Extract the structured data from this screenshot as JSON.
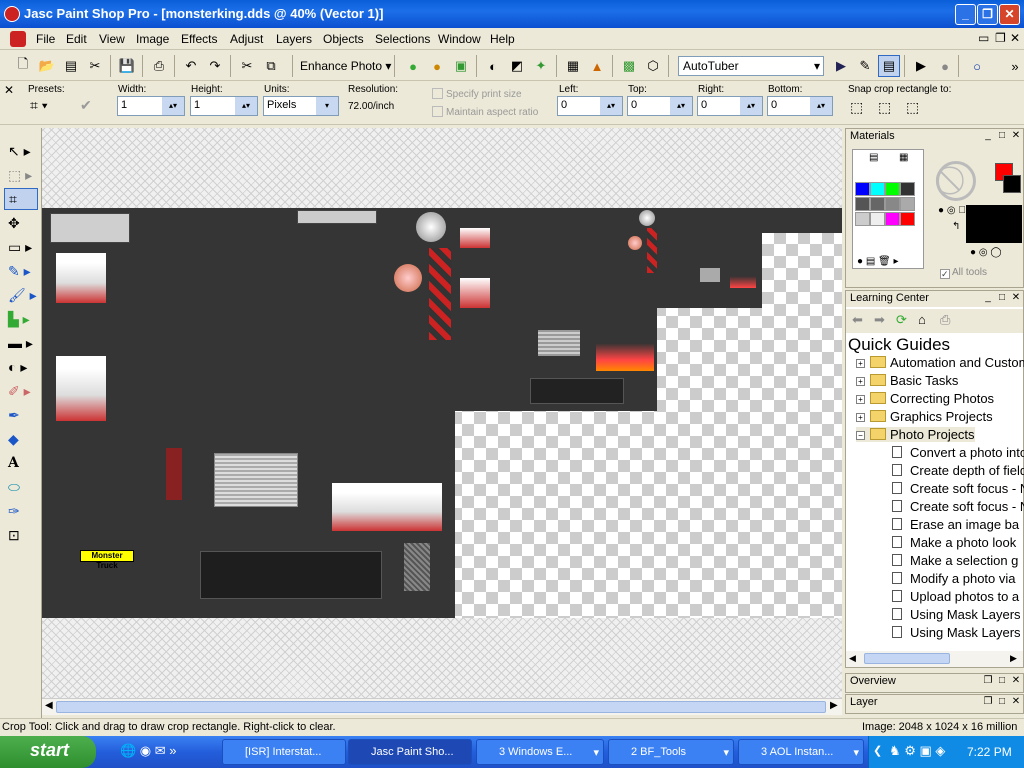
{
  "window": {
    "title": "Jasc Paint Shop Pro - [monsterking.dds @  40% (Vector 1)]",
    "buttons": {
      "min": "_",
      "max": "❐",
      "close": "✕"
    }
  },
  "menu": {
    "items": [
      {
        "label": "File"
      },
      {
        "label": "Edit"
      },
      {
        "label": "View"
      },
      {
        "label": "Image"
      },
      {
        "label": "Effects"
      },
      {
        "label": "Adjust"
      },
      {
        "label": "Layers"
      },
      {
        "label": "Objects"
      },
      {
        "label": "Selections"
      },
      {
        "label": "Window"
      },
      {
        "label": "Help"
      }
    ]
  },
  "toolbar": {
    "enhance_photo": "Enhance Photo",
    "script_select": "AutoTuber"
  },
  "tool_options": {
    "presets_label": "Presets:",
    "width_label": "Width:",
    "width_value": "1",
    "height_label": "Height:",
    "height_value": "1",
    "units_label": "Units:",
    "units_value": "Pixels",
    "resolution_label": "Resolution:",
    "resolution_value": "72.00/inch",
    "specify_print_size": "Specify print size",
    "maintain_aspect_ratio": "Maintain aspect ratio",
    "left_label": "Left:",
    "left_value": "0",
    "top_label": "Top:",
    "top_value": "0",
    "right_label": "Right:",
    "right_value": "0",
    "bottom_label": "Bottom:",
    "bottom_value": "0",
    "snap_label": "Snap crop rectangle to:"
  },
  "canvas": {
    "texture_label": "Monster Truck"
  },
  "materials": {
    "title": "Materials",
    "all_tools": "All tools",
    "foreground_color": "#ff0000",
    "background_color": "#000000"
  },
  "learning_center": {
    "title": "Learning Center",
    "heading": "Quick Guides",
    "folders": [
      {
        "label": "Automation and Custom",
        "expanded": false
      },
      {
        "label": "Basic Tasks",
        "expanded": false
      },
      {
        "label": "Correcting Photos",
        "expanded": false
      },
      {
        "label": "Graphics Projects",
        "expanded": false
      },
      {
        "label": "Photo Projects",
        "expanded": true
      }
    ],
    "items": [
      "Convert a photo into",
      "Create depth of field",
      "Create soft focus - N",
      "Create soft focus - N",
      "Erase an image ba",
      "Make a photo look",
      "Make a selection g",
      "Modify a photo via",
      "Upload photos to a",
      "Using Mask Layers",
      "Using Mask Layers"
    ]
  },
  "overview": {
    "title": "Overview"
  },
  "layer_panel": {
    "title": "Layer"
  },
  "status": {
    "hint": "Crop Tool: Click and drag to draw crop rectangle. Right-click to clear.",
    "image_info": "Image:  2048 x 1024 x 16 million"
  },
  "taskbar": {
    "start": "start",
    "tasks": [
      {
        "label": "[ISR] Interstat..."
      },
      {
        "label": "Jasc Paint Sho..."
      },
      {
        "label": "3 Windows E..."
      },
      {
        "label": "2 BF_Tools"
      },
      {
        "label": "3 AOL Instan..."
      }
    ],
    "clock": "7:22 PM"
  }
}
